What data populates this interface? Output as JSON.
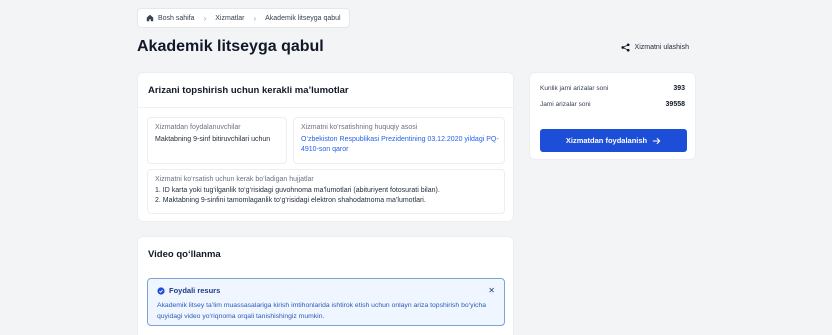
{
  "breadcrumb": {
    "home": "Bosh sahifa",
    "services": "Xizmatlar",
    "current": "Akademik litseyga qabul"
  },
  "page": {
    "title": "Akademik litseyga qabul",
    "share_label": "Xizmatni ulashish"
  },
  "requirements": {
    "title": "Arizani topshirish uchun kerakli ma’lumotlar",
    "users_label": "Xizmatdan foydalanuvchilar",
    "users_value": "Maktabning 9-sinf bitiruvchilari uchun",
    "legal_label": "Xizmatni ko‘rsatishning huquqiy asosi",
    "legal_value": "O‘zbekiston Respublikasi Prezidentining 03.12.2020 yildagi PQ-4910-son qaror",
    "docs_label": "Xizmatni ko‘rsatish uchun kerak bo‘ladigan hujjatlar",
    "docs_line1": "1. ID karta yoki tug‘ilganlik to‘g‘risidagi guvohnoma ma’lumotlari (abituriyent fotosurati bilan).",
    "docs_line2": "2. Maktabning 9-sinfini tamomlaganlik to‘g‘risidagi elektron shahodatnoma ma’lumotlari."
  },
  "stats": {
    "daily_label": "Kunlik jami arizalar soni",
    "daily_value": "393",
    "total_label": "Jami arizalar soni",
    "total_value": "39558",
    "cta_label": "Xizmatdan foydalanish"
  },
  "video": {
    "title": "Video qo‘llanma",
    "alert_title": "Foydali resurs",
    "alert_body": "Akademik litsey ta’lim muassasalariga kirish imtihonlarida ishtirok etish uchun onlayn ariza topshirish bo‘yicha quyidagi video yo‘riqnoma orqali tanishishingiz mumkin."
  },
  "colors": {
    "accent": "#1d4ed8",
    "link": "#2563eb",
    "alert_bg": "#eff6ff"
  }
}
